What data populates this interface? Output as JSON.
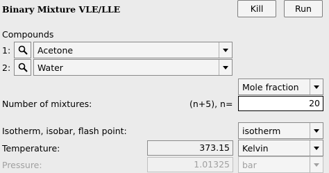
{
  "header": {
    "title": "Binary Mixture VLE/LLE",
    "kill_label": "Kill",
    "run_label": "Run"
  },
  "compounds": {
    "label": "Compounds",
    "items": [
      {
        "index": "1:",
        "value": "Acetone"
      },
      {
        "index": "2:",
        "value": "Water"
      }
    ]
  },
  "fraction_select": {
    "value": "Mole fraction"
  },
  "mixtures": {
    "label": "Number of mixtures:",
    "hint": "(n+5), n=",
    "value": "20"
  },
  "mode": {
    "label": "Isotherm, isobar, flash point:",
    "value": "isotherm"
  },
  "temperature": {
    "label": "Temperature:",
    "value": "373.15",
    "unit": "Kelvin"
  },
  "pressure": {
    "label": "Pressure:",
    "value": "1.01325",
    "unit": "bar",
    "enabled": false
  }
}
